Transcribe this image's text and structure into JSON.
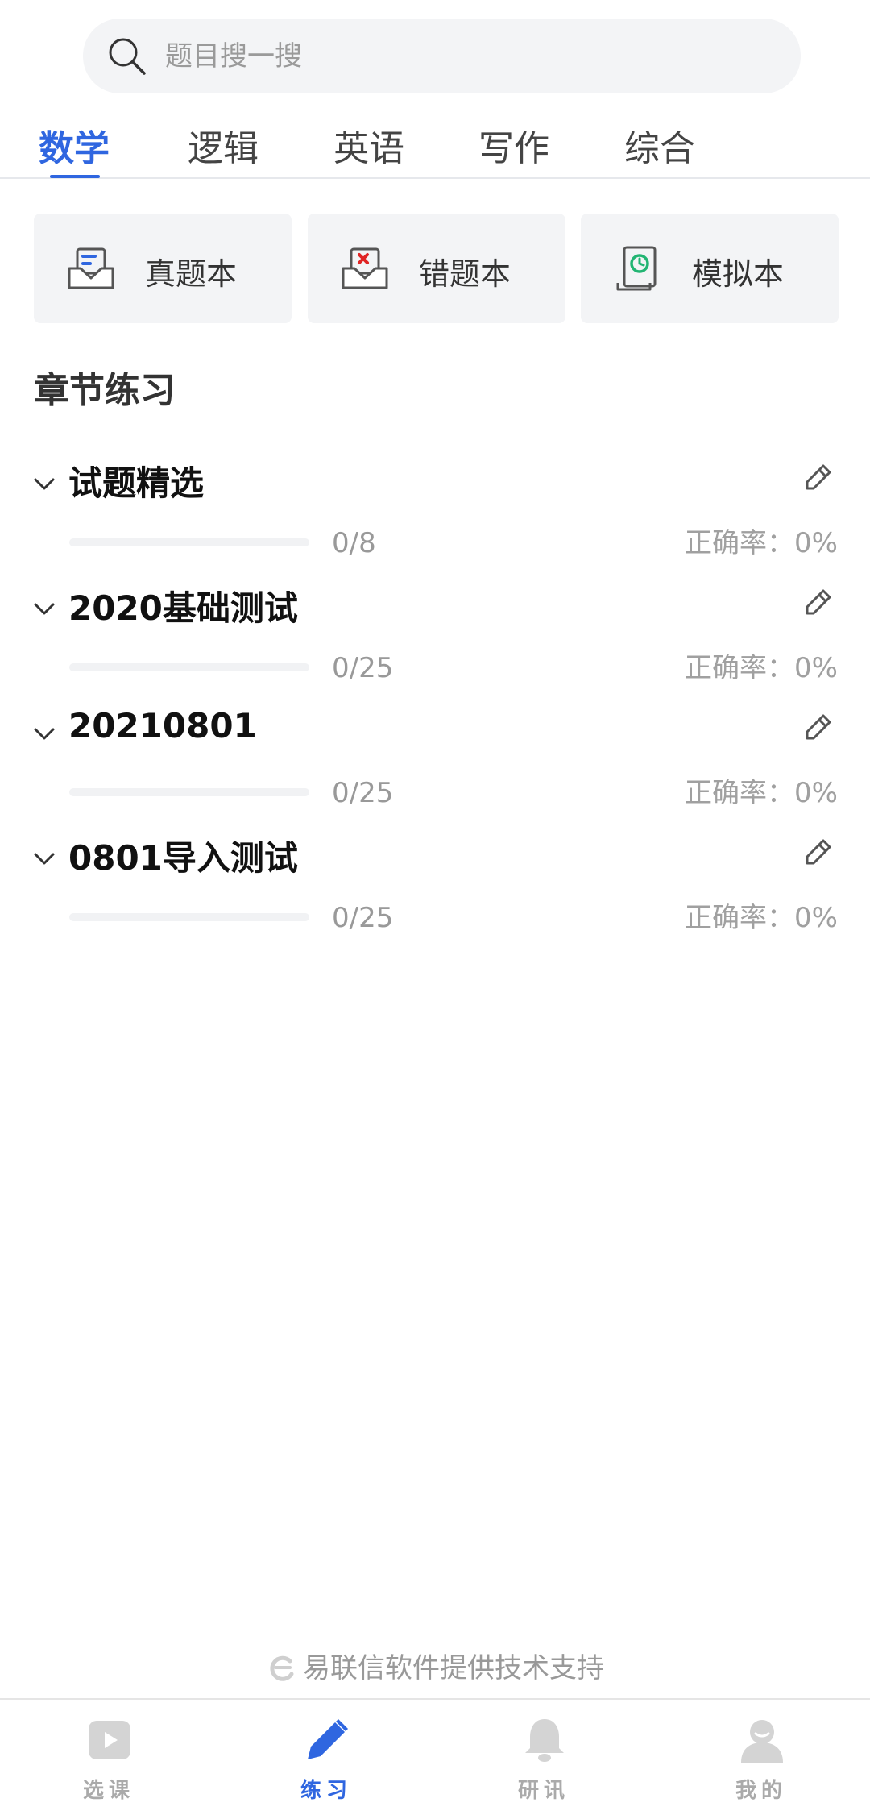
{
  "search": {
    "placeholder": "题目搜一搜"
  },
  "tabs": [
    {
      "label": "数学",
      "active": true
    },
    {
      "label": "逻辑",
      "active": false
    },
    {
      "label": "英语",
      "active": false
    },
    {
      "label": "写作",
      "active": false
    },
    {
      "label": "综合",
      "active": false
    }
  ],
  "tools": [
    {
      "label": "真题本",
      "icon": "inbox-doc-icon"
    },
    {
      "label": "错题本",
      "icon": "inbox-error-icon"
    },
    {
      "label": "模拟本",
      "icon": "scroll-clock-icon"
    }
  ],
  "section_title": "章节练习",
  "chapters": [
    {
      "title": "试题精选",
      "count": "0/8",
      "rate": "正确率：0%",
      "progress": 0
    },
    {
      "title": "2020基础测试",
      "count": "0/25",
      "rate": "正确率：0%",
      "progress": 0
    },
    {
      "title": "20210801",
      "count": "0/25",
      "rate": "正确率：0%",
      "progress": 0
    },
    {
      "title": "0801导入测试",
      "count": "0/25",
      "rate": "正确率：0%",
      "progress": 0
    }
  ],
  "footer_note": "易联信软件提供技术支持",
  "bottom_nav": [
    {
      "label": "选课",
      "icon": "play-icon",
      "active": false
    },
    {
      "label": "练习",
      "icon": "pencil-icon",
      "active": true
    },
    {
      "label": "研讯",
      "icon": "bell-icon",
      "active": false
    },
    {
      "label": "我的",
      "icon": "user-icon",
      "active": false
    }
  ],
  "colors": {
    "accent": "#2f66e0",
    "inactive": "#aaaaaa",
    "tool_bg": "#f3f4f6",
    "error_red": "#e02424",
    "mock_green": "#22b573"
  }
}
